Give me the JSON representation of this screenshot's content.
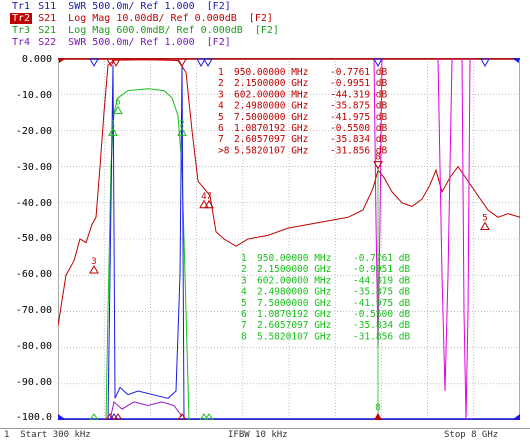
{
  "traces": [
    {
      "tag": "Tr1",
      "text": " S11  SWR 500.0m/ Ref 1.000  [F2]",
      "color": "#1a1aa6",
      "active": false
    },
    {
      "tag": "Tr2",
      "text": " S21  Log Mag 10.00dB/ Ref 0.000dB  [F2]",
      "color": "#c00000",
      "active": true
    },
    {
      "tag": "Tr3",
      "text": " S21  Log Mag 600.0mdB/ Ref 0.000dB  [F2]",
      "color": "#1a9a1a",
      "active": false
    },
    {
      "tag": "Tr4",
      "text": " S22  SWR 500.0m/ Ref 1.000  [F2]",
      "color": "#7a18b8",
      "active": false
    }
  ],
  "y_axis_labels": [
    "0.000",
    "-10.00",
    "-20.00",
    "-30.00",
    "-40.00",
    "-50.00",
    "-60.00",
    "-70.00",
    "-80.00",
    "-90.00",
    "-100.0"
  ],
  "markers_red": [
    {
      "n": "1",
      "freq": "950.00000 MHz",
      "val": "-0.7761 dB"
    },
    {
      "n": "2",
      "freq": "2.1500000 GHz",
      "val": "-0.9951 dB"
    },
    {
      "n": "3",
      "freq": "602.00000 MHz",
      "val": "-44.319 dB"
    },
    {
      "n": "4",
      "freq": "2.4980000 GHz",
      "val": "-35.875 dB"
    },
    {
      "n": "5",
      "freq": "7.5000000 GHz",
      "val": "-41.975 dB"
    },
    {
      "n": "6",
      "freq": "1.0870192 GHz",
      "val": "-0.5500 dB"
    },
    {
      "n": "7",
      "freq": "2.6057097 GHz",
      "val": "-35.834 dB"
    },
    {
      "n": ">8",
      "freq": "5.5820107 GHz",
      "val": "-31.856 dB"
    }
  ],
  "markers_green": [
    {
      "n": "1",
      "freq": "950.00000 MHz",
      "val": "-0.7761 dB"
    },
    {
      "n": "2",
      "freq": "2.1500000 GHz",
      "val": "-0.9951 dB"
    },
    {
      "n": "3",
      "freq": "602.00000 MHz",
      "val": "-44.319 dB"
    },
    {
      "n": "4",
      "freq": "2.4980000 GHz",
      "val": "-35.875 dB"
    },
    {
      "n": "5",
      "freq": "7.5000000 GHz",
      "val": "-41.975 dB"
    },
    {
      "n": "6",
      "freq": "1.0870192 GHz",
      "val": "-0.5500 dB"
    },
    {
      "n": "7",
      "freq": "2.6057097 GHz",
      "val": "-35.834 dB"
    },
    {
      "n": "8",
      "freq": "5.5820107 GHz",
      "val": "-31.856 dB"
    }
  ],
  "status": {
    "left": "1  Start 300 kHz",
    "mid": "IFBW 10 kHz",
    "right": "Stop 8 GHz"
  },
  "colors": {
    "red": "#c00000",
    "green": "#19c019",
    "blue": "#1a1ae6",
    "purple": "#8c1cc8",
    "magenta": "#e000e0",
    "grid": "#9a9a9a"
  }
}
